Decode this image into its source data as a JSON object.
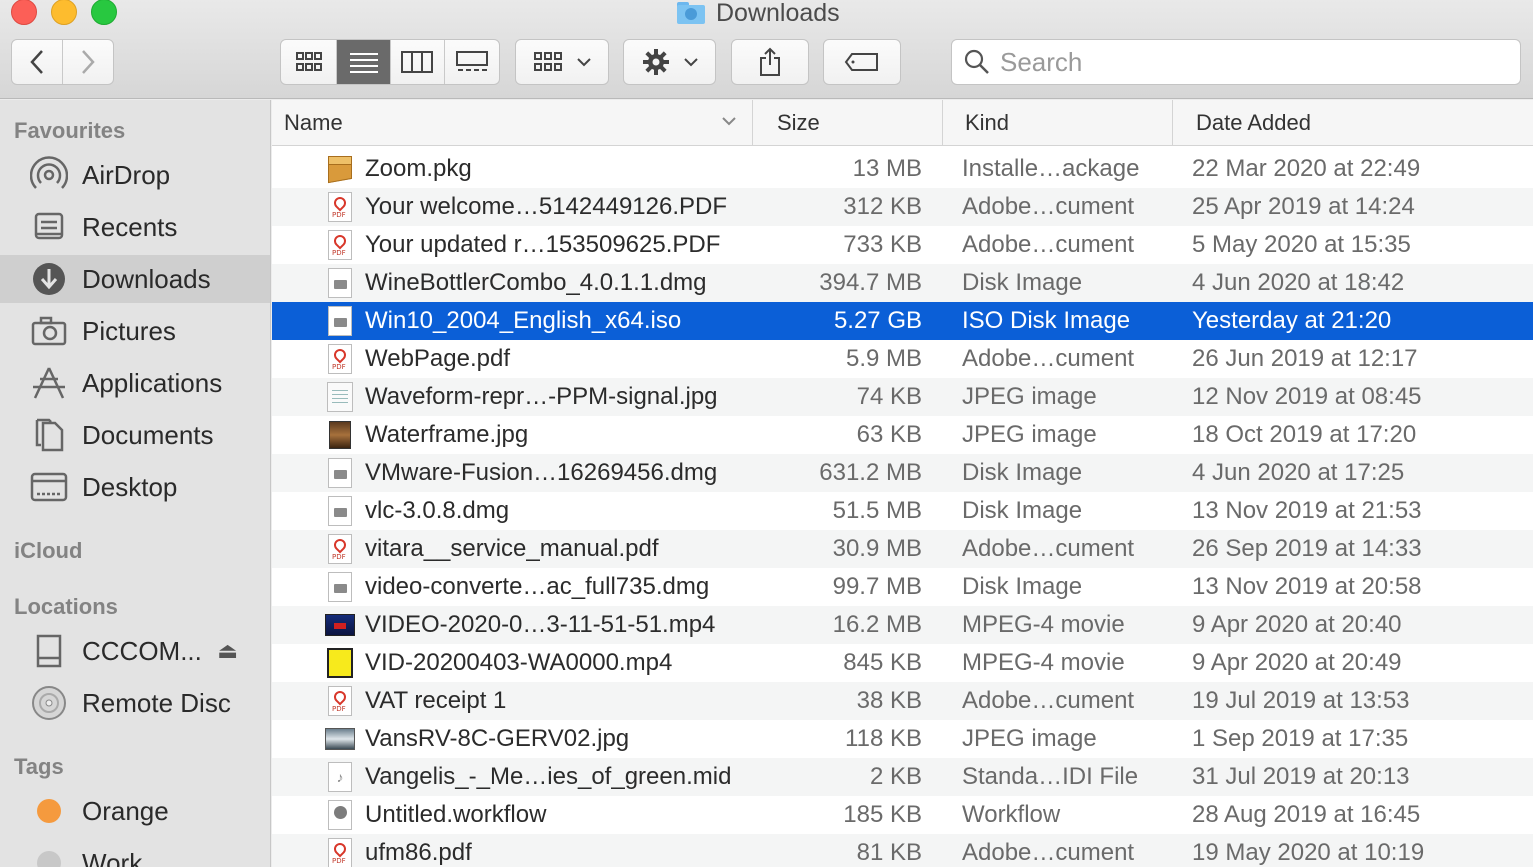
{
  "window": {
    "title": "Downloads"
  },
  "search": {
    "placeholder": "Search"
  },
  "sidebar": {
    "favourites_heading": "Favourites",
    "favourites": [
      {
        "label": "AirDrop",
        "icon": "airdrop-icon"
      },
      {
        "label": "Recents",
        "icon": "recents-icon"
      },
      {
        "label": "Downloads",
        "icon": "downloads-icon",
        "active": true
      },
      {
        "label": "Pictures",
        "icon": "camera-icon"
      },
      {
        "label": "Applications",
        "icon": "applications-icon"
      },
      {
        "label": "Documents",
        "icon": "document-icon"
      },
      {
        "label": "Desktop",
        "icon": "desktop-icon"
      }
    ],
    "icloud_heading": "iCloud",
    "locations_heading": "Locations",
    "locations": [
      {
        "label": "CCCOM...",
        "icon": "drive-icon",
        "eject": "⏏"
      },
      {
        "label": "Remote Disc",
        "icon": "disc-icon"
      }
    ],
    "tags_heading": "Tags",
    "tags": [
      {
        "label": "Orange",
        "color": "#f59a3e"
      },
      {
        "label": "Work",
        "color": "#c8c8c8"
      }
    ]
  },
  "columns": {
    "name": "Name",
    "size": "Size",
    "kind": "Kind",
    "date": "Date Added"
  },
  "files": [
    {
      "name": "Zoom.pkg",
      "size": "13 MB",
      "kind": "Installe…ackage",
      "date": "22 Mar 2020 at 22:49",
      "icon": "package-icon"
    },
    {
      "name": "Your welcome…5142449126.PDF",
      "size": "312 KB",
      "kind": "Adobe…cument",
      "date": "25 Apr 2019 at 14:24",
      "icon": "pdf-icon"
    },
    {
      "name": "Your updated r…153509625.PDF",
      "size": "733 KB",
      "kind": "Adobe…cument",
      "date": "5 May 2020 at 15:35",
      "icon": "pdf-icon"
    },
    {
      "name": "WineBottlerCombo_4.0.1.1.dmg",
      "size": "394.7 MB",
      "kind": "Disk Image",
      "date": "4 Jun 2020 at 18:42",
      "icon": "disk-image-icon"
    },
    {
      "name": "Win10_2004_English_x64.iso",
      "size": "5.27 GB",
      "kind": "ISO Disk Image",
      "date": "Yesterday at 21:20",
      "icon": "disk-image-icon",
      "selected": true
    },
    {
      "name": "WebPage.pdf",
      "size": "5.9 MB",
      "kind": "Adobe…cument",
      "date": "26 Jun 2019 at 12:17",
      "icon": "pdf-icon"
    },
    {
      "name": "Waveform-repr…-PPM-signal.jpg",
      "size": "74 KB",
      "kind": "JPEG image",
      "date": "12 Nov 2019 at 08:45",
      "icon": "jpeg-icon"
    },
    {
      "name": "Waterframe.jpg",
      "size": "63 KB",
      "kind": "JPEG image",
      "date": "18 Oct 2019 at 17:20",
      "icon": "photo-icon"
    },
    {
      "name": "VMware-Fusion…16269456.dmg",
      "size": "631.2 MB",
      "kind": "Disk Image",
      "date": "4 Jun 2020 at 17:25",
      "icon": "disk-image-icon"
    },
    {
      "name": "vlc-3.0.8.dmg",
      "size": "51.5 MB",
      "kind": "Disk Image",
      "date": "13 Nov 2019 at 21:53",
      "icon": "disk-image-icon"
    },
    {
      "name": "vitara__service_manual.pdf",
      "size": "30.9 MB",
      "kind": "Adobe…cument",
      "date": "26 Sep 2019 at 14:33",
      "icon": "pdf-icon"
    },
    {
      "name": "video-converte…ac_full735.dmg",
      "size": "99.7 MB",
      "kind": "Disk Image",
      "date": "13 Nov 2019 at 20:58",
      "icon": "disk-image-icon"
    },
    {
      "name": "VIDEO-2020-0…3-11-51-51.mp4",
      "size": "16.2 MB",
      "kind": "MPEG-4 movie",
      "date": "9 Apr 2020 at 20:40",
      "icon": "movie-icon"
    },
    {
      "name": "VID-20200403-WA0000.mp4",
      "size": "845 KB",
      "kind": "MPEG-4 movie",
      "date": "9 Apr 2020 at 20:49",
      "icon": "movie-yellow-icon"
    },
    {
      "name": "VAT receipt 1",
      "size": "38 KB",
      "kind": "Adobe…cument",
      "date": "19 Jul 2019 at 13:53",
      "icon": "pdf-icon"
    },
    {
      "name": "VansRV-8C-GERV02.jpg",
      "size": "118 KB",
      "kind": "JPEG image",
      "date": "1 Sep 2019 at 17:35",
      "icon": "landscape-icon"
    },
    {
      "name": "Vangelis_-_Me…ies_of_green.mid",
      "size": "2 KB",
      "kind": "Standa…IDI File",
      "date": "31 Jul 2019 at 20:13",
      "icon": "midi-icon"
    },
    {
      "name": "Untitled.workflow",
      "size": "185 KB",
      "kind": "Workflow",
      "date": "28 Aug 2019 at 16:45",
      "icon": "workflow-icon"
    },
    {
      "name": "ufm86.pdf",
      "size": "81 KB",
      "kind": "Adobe…cument",
      "date": "19 May 2020 at 10:19",
      "icon": "pdf-icon"
    }
  ],
  "colors": {
    "selection": "#0b5fd7",
    "accent_orange": "#f59a3e"
  }
}
